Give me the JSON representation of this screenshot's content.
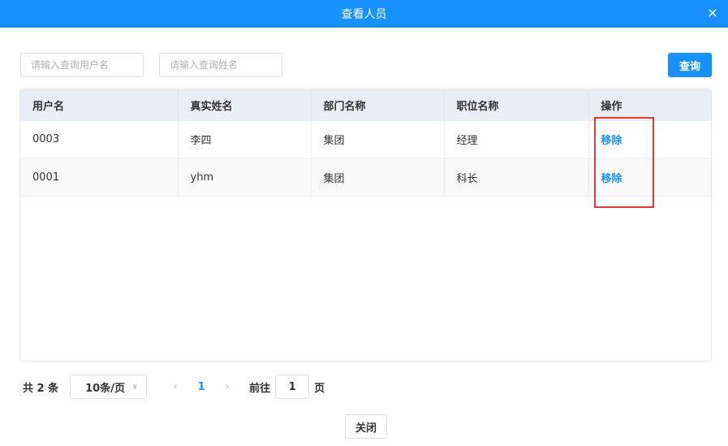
{
  "dialog": {
    "title": "查看人员",
    "close_icon": "×"
  },
  "filters": {
    "username_placeholder": "请输入查询用户名",
    "realname_placeholder": "请输入查询姓名",
    "query_label": "查询"
  },
  "table": {
    "columns": [
      "用户名",
      "真实姓名",
      "部门名称",
      "职位名称",
      "操作"
    ],
    "rows": [
      {
        "username": "0003",
        "realname": "李四",
        "department": "集团",
        "position": "经理",
        "action": "移除"
      },
      {
        "username": "0001",
        "realname": "yhm",
        "department": "集团",
        "position": "科长",
        "action": "移除"
      }
    ]
  },
  "pagination": {
    "total_text": "共 2 条",
    "page_size": "10条/页",
    "prev_icon": "‹",
    "current_page": "1",
    "next_icon": "›",
    "goto_label": "前往",
    "goto_value": "1",
    "goto_unit": "页"
  },
  "footer": {
    "close_label": "关闭"
  },
  "colors": {
    "primary": "#1890ff",
    "highlight": "#e53935"
  }
}
